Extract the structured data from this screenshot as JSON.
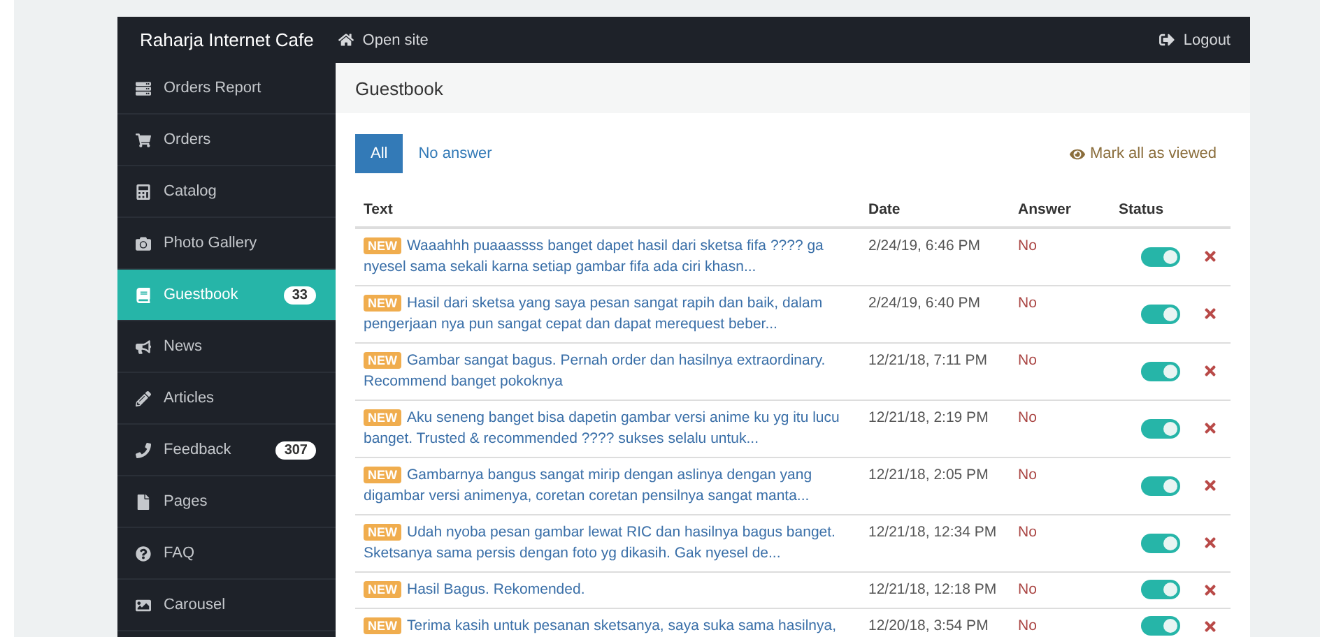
{
  "header": {
    "brand": "Raharja Internet Cafe",
    "open_site": "Open site",
    "logout": "Logout"
  },
  "sidebar": {
    "items": [
      {
        "kind": "report",
        "label": "Orders Report",
        "selected": false
      },
      {
        "kind": "cart",
        "label": "Orders",
        "selected": false
      },
      {
        "kind": "catalog",
        "label": "Catalog",
        "selected": false
      },
      {
        "kind": "camera",
        "label": "Photo Gallery",
        "selected": false
      },
      {
        "kind": "book",
        "label": "Guestbook",
        "selected": true,
        "badge": "33"
      },
      {
        "kind": "bullhorn",
        "label": "News",
        "selected": false
      },
      {
        "kind": "pencil",
        "label": "Articles",
        "selected": false
      },
      {
        "kind": "phone",
        "label": "Feedback",
        "selected": false,
        "badge": "307"
      },
      {
        "kind": "file",
        "label": "Pages",
        "selected": false
      },
      {
        "kind": "question",
        "label": "FAQ",
        "selected": false
      },
      {
        "kind": "image",
        "label": "Carousel",
        "selected": false
      }
    ]
  },
  "page": {
    "title": "Guestbook",
    "tabs": [
      {
        "label": "All",
        "selected": true
      },
      {
        "label": "No answer",
        "selected": false
      }
    ],
    "mark_all": "Mark all as viewed",
    "table": {
      "columns": [
        "Text",
        "Date",
        "Answer",
        "Status"
      ],
      "rows": [
        {
          "badge": "NEW",
          "text": "Waaahhh puaaassss banget dapet hasil dari sketsa fifa ???? ga nyesel sama sekali karna setiap gambar fifa ada ciri khasn...",
          "date": "2/24/19, 6:46 PM",
          "answer": "No",
          "on": true
        },
        {
          "badge": "NEW",
          "text": "Hasil dari sketsa yang saya pesan sangat rapih dan baik, dalam pengerjaan nya pun sangat cepat dan dapat merequest beber...",
          "date": "2/24/19, 6:40 PM",
          "answer": "No",
          "on": true
        },
        {
          "badge": "NEW",
          "text": "Gambar sangat bagus. Pernah order dan hasilnya extraordinary. Recommend banget pokoknya",
          "date": "12/21/18, 7:11 PM",
          "answer": "No",
          "on": true
        },
        {
          "badge": "NEW",
          "text": "Aku seneng banget bisa dapetin gambar versi anime ku yg itu lucu banget. Trusted & recommended ???? sukses selalu untuk...",
          "date": "12/21/18, 2:19 PM",
          "answer": "No",
          "on": true
        },
        {
          "badge": "NEW",
          "text": "Gambarnya bangus sangat mirip dengan aslinya dengan yang digambar versi animenya, coretan coretan pensilnya sangat manta...",
          "date": "12/21/18, 2:05 PM",
          "answer": "No",
          "on": true
        },
        {
          "badge": "NEW",
          "text": "Udah nyoba pesan gambar lewat RIC dan hasilnya bagus banget. Sketsanya sama persis dengan foto yg dikasih. Gak nyesel de...",
          "date": "12/21/18, 12:34 PM",
          "answer": "No",
          "on": true
        },
        {
          "badge": "NEW",
          "text": "Hasil Bagus. Rekomended.",
          "date": "12/21/18, 12:18 PM",
          "answer": "No",
          "on": true
        },
        {
          "badge": "NEW",
          "text": "Terima kasih untuk pesanan sketsanya, saya suka sama hasilnya,",
          "date": "12/20/18, 3:54 PM",
          "answer": "No",
          "on": true
        }
      ]
    }
  }
}
